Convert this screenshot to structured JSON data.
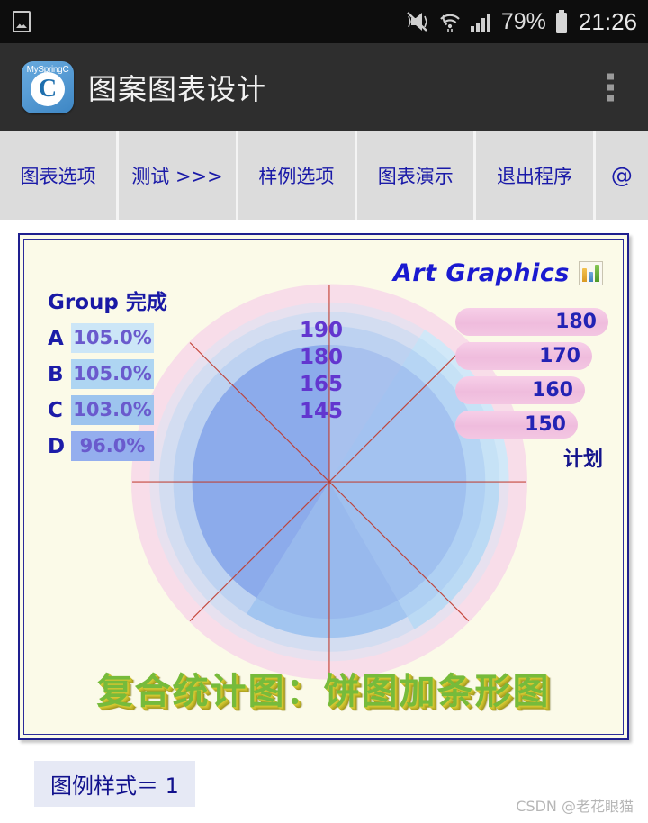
{
  "status_bar": {
    "left_icon": "photo-icon",
    "icons": [
      "vibrate-mute-icon",
      "wifi-icon",
      "signal-bars-icon",
      "battery-icon"
    ],
    "battery_percent": "79%",
    "clock": "21:26"
  },
  "app_header": {
    "icon_label": "MySpringC",
    "icon_letter": "C",
    "title": "图案图表设计",
    "overflow_menu": "overflow-menu-icon"
  },
  "tabs": [
    {
      "label": "图表选项"
    },
    {
      "label": "测试 >>>"
    },
    {
      "label": "样例选项"
    },
    {
      "label": "图表演示"
    },
    {
      "label": "退出程序"
    },
    {
      "label": "@"
    }
  ],
  "chart_panel": {
    "art_title": "Art Graphics",
    "art_icon": "bar-chart-icon",
    "left_legend_title": "Group 完成",
    "right_plan_label": "计划",
    "bottom_title": "复合统计图：饼图加条形图"
  },
  "footer": {
    "legend_style_button": "图例样式＝ 1",
    "watermark": "CSDN @老花眼猫"
  },
  "chart_data": {
    "type": "pie",
    "title": "复合统计图：饼图加条形图",
    "subtitle": "Art Graphics",
    "legend_position": "left-and-right",
    "grid": false,
    "groups": [
      "A",
      "B",
      "C",
      "D"
    ],
    "completion_label": "Group 完成",
    "completion_values": [
      "105.0%",
      "105.0%",
      "103.0%",
      "96.0%"
    ],
    "completion_numeric": [
      105.0,
      105.0,
      103.0,
      96.0
    ],
    "completion_colors": [
      "#cce6f7",
      "#aed5f2",
      "#9dc4ee",
      "#94aeee"
    ],
    "plan_label": "计划",
    "plan_values": [
      180,
      170,
      160,
      150
    ],
    "plan_color": "#f0bddf",
    "actual_labels": [
      "190",
      "180",
      "165",
      "145"
    ],
    "actual_values": [
      190,
      180,
      165,
      145
    ],
    "actual_label_color": "#6236cf",
    "outer_ring_color": "#f7d7e9",
    "sector_colors": [
      "#cfe8f8",
      "#b8d9f4",
      "#a0c3f0",
      "#8aa9ea"
    ],
    "axis_line_color": "#c0392b",
    "axis_count": 8,
    "panel_background": "#fbfae8",
    "panel_border": "#1f1f8f",
    "accent_blue": "#1a1ad0",
    "title_color": "#76bb3b",
    "title_shadow_color": "#c9bd2c"
  }
}
